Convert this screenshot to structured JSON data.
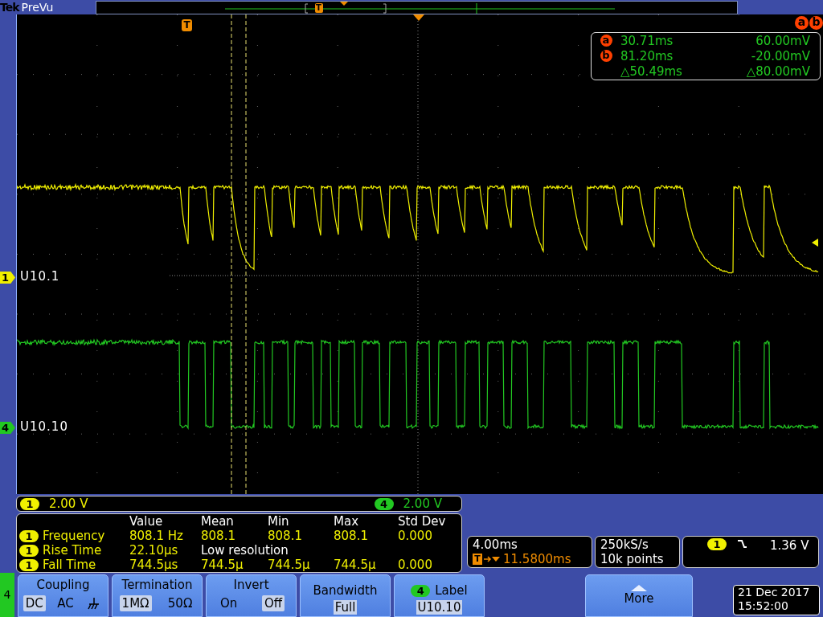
{
  "header": {
    "brand": "Tek",
    "mode": "PreVu",
    "trigger_label": "T"
  },
  "graticule": {
    "trigger_label": "T",
    "cursor_flags": [
      "a",
      "b"
    ]
  },
  "channels": [
    {
      "marker": "1",
      "label": "U10.1",
      "color": "#f0f000"
    },
    {
      "marker": "4",
      "label": "U10.10",
      "color": "#22c822"
    }
  ],
  "cursor_readout": [
    {
      "kind": "cursor",
      "marker": "a",
      "time": "30.71ms",
      "value": "60.00mV"
    },
    {
      "kind": "cursor",
      "marker": "b",
      "time": "81.20ms",
      "value": "-20.00mV"
    },
    {
      "kind": "delta",
      "time": "△50.49ms",
      "value": "△80.00mV"
    }
  ],
  "scales": [
    {
      "channel": "1",
      "value": "2.00 V",
      "color": "#f0f000"
    },
    {
      "channel": "4",
      "value": "2.00 V",
      "color": "#22c822"
    }
  ],
  "measurements": {
    "columns": [
      "Value",
      "Mean",
      "Min",
      "Max",
      "Std Dev"
    ],
    "rows": [
      {
        "kind": "stats",
        "channel": "1",
        "name": "Frequency",
        "value": "808.1 Hz",
        "mean": "808.1",
        "min": "808.1",
        "max": "808.1",
        "std_dev": "0.000"
      },
      {
        "kind": "note",
        "channel": "1",
        "name": "Rise Time",
        "value": "22.10µs",
        "note": "Low resolution"
      },
      {
        "kind": "stats",
        "channel": "1",
        "name": "Fall Time",
        "value": "744.5µs",
        "mean": "744.5µ",
        "min": "744.5µ",
        "max": "744.5µ",
        "std_dev": "0.000"
      }
    ]
  },
  "timebase": {
    "scale": "4.00ms",
    "trigger_label": "T",
    "delay": "11.5800ms"
  },
  "acquisition": {
    "rate": "250kS/s",
    "points": "10k points"
  },
  "trigger": {
    "channel": "1",
    "level": "1.36 V"
  },
  "menu": {
    "channel": "4",
    "items": [
      {
        "kind": "options",
        "title": "Coupling",
        "options": [
          {
            "kind": "text",
            "label": "DC",
            "selected": true
          },
          {
            "kind": "text",
            "label": "AC",
            "selected": false
          },
          {
            "kind": "ground",
            "selected": false
          }
        ]
      },
      {
        "kind": "options",
        "title": "Termination",
        "options": [
          {
            "kind": "text",
            "label": "1MΩ",
            "selected": true
          },
          {
            "kind": "text",
            "label": "50Ω",
            "selected": false
          }
        ]
      },
      {
        "kind": "options",
        "title": "Invert",
        "options": [
          {
            "kind": "text",
            "label": "On",
            "selected": false
          },
          {
            "kind": "text",
            "label": "Off",
            "selected": true
          }
        ]
      },
      {
        "kind": "value",
        "title": "Bandwidth",
        "value": "Full"
      },
      {
        "kind": "label",
        "channel": "4",
        "title": "Label",
        "value": "U10.10"
      },
      {
        "kind": "more",
        "title": "More"
      }
    ]
  },
  "datetime": {
    "date": "21 Dec 2017",
    "time": "15:52:00"
  }
}
